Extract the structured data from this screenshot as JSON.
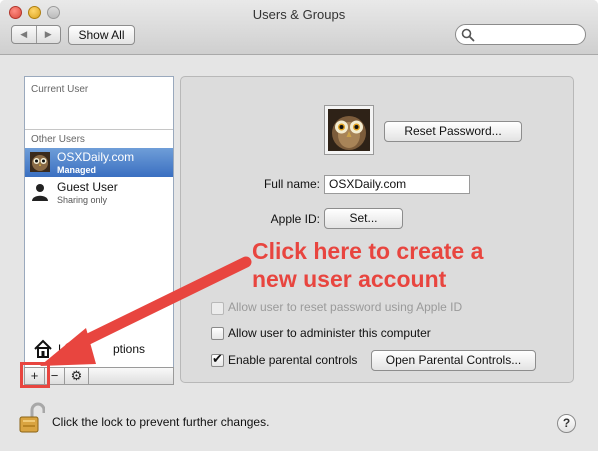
{
  "window": {
    "title": "Users & Groups"
  },
  "toolbar": {
    "show_all": "Show All",
    "back_icon": "back-arrow",
    "forward_icon": "forward-arrow"
  },
  "search": {
    "placeholder": "",
    "icon": "search-icon"
  },
  "sidebar": {
    "current_user_header": "Current User",
    "other_users_header": "Other Users",
    "users": [
      {
        "name": "OSXDaily.com",
        "subtitle": "Managed",
        "selected": true,
        "avatar": "owl"
      },
      {
        "name": "Guest User",
        "subtitle": "Sharing only",
        "selected": false,
        "avatar": "person-silhouette"
      }
    ],
    "login_options_label": "Login Options",
    "login_options_visible": "L",
    "login_options_hidden": "ptions",
    "add_label": "+",
    "remove_label": "−",
    "action_label": "⚙"
  },
  "detail": {
    "reset_password": "Reset Password...",
    "full_name_label": "Full name:",
    "full_name_value": "OSXDaily.com",
    "apple_id_label": "Apple ID:",
    "set_button": "Set...",
    "options": [
      {
        "label": "Allow user to reset password using Apple ID",
        "checked": false,
        "disabled": true
      },
      {
        "label": "Allow user to administer this computer",
        "checked": false,
        "disabled": false
      },
      {
        "label": "Enable parental controls",
        "checked": true,
        "disabled": false
      }
    ],
    "open_parental_controls": "Open Parental Controls..."
  },
  "annotation": {
    "line1": "Click here to create a",
    "line2": "new user account",
    "color": "#e8453f"
  },
  "footer": {
    "lock_text": "Click the lock to prevent further changes.",
    "help": "?"
  },
  "colors": {
    "selection": "#3f74c4",
    "annotation": "#e8453f"
  }
}
